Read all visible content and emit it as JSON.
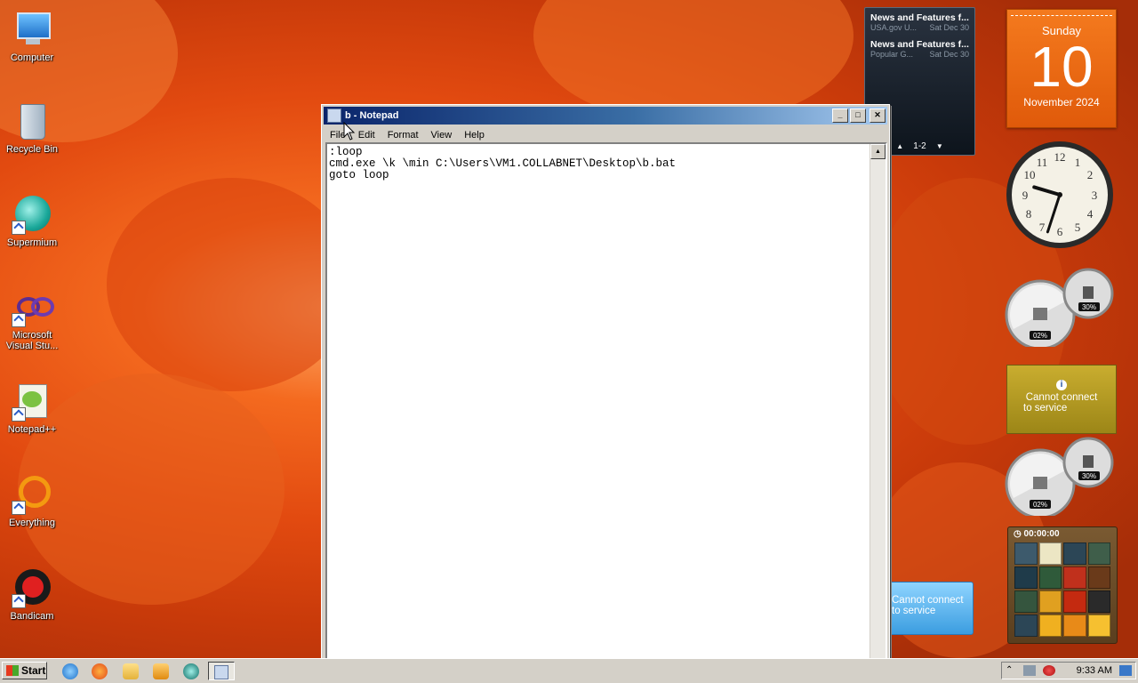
{
  "desktop": {
    "icons": [
      {
        "label": "Computer",
        "icon": "computer-icon"
      },
      {
        "label": "Recycle Bin",
        "icon": "recycle-bin-icon"
      },
      {
        "label": "Supermium",
        "icon": "supermium-icon"
      },
      {
        "label": "Microsoft Visual Stu...",
        "icon": "visual-studio-icon"
      },
      {
        "label": "Notepad++",
        "icon": "notepadpp-icon"
      },
      {
        "label": "Everything",
        "icon": "everything-icon"
      },
      {
        "label": "Bandicam",
        "icon": "bandicam-icon"
      }
    ]
  },
  "notepad": {
    "title": "b - Notepad",
    "menu": [
      "File",
      "Edit",
      "Format",
      "View",
      "Help"
    ],
    "content": ":loop\ncmd.exe \\k \\min C:\\Users\\VM1.COLLABNET\\Desktop\\b.bat\ngoto loop",
    "buttons": {
      "minimize": "_",
      "maximize": "□",
      "close": "✕"
    }
  },
  "gadgets": {
    "news": {
      "items": [
        {
          "headline": "News and Features f...",
          "source": "USA.gov U...",
          "date": "Sat Dec 30"
        },
        {
          "headline": "News and Features f...",
          "source": "Popular G...",
          "date": "Sat Dec 30"
        }
      ],
      "pager": "1-2"
    },
    "calendar": {
      "weekday": "Sunday",
      "day": "10",
      "month_year": "November 2024"
    },
    "clock": {
      "hour": 9,
      "minute": 33
    },
    "meters": [
      {
        "cpu": "02%",
        "memory": "30%"
      },
      {
        "cpu": "02%",
        "memory": "30%"
      }
    ],
    "weather_1": {
      "line1": "Cannot connect",
      "line2": "to service"
    },
    "weather_2": {
      "line1": "Cannot connect",
      "line2": "to service"
    },
    "puzzle": {
      "timer": "00:00:00"
    }
  },
  "taskbar": {
    "start_label": "Start",
    "clock": "9:33 AM"
  },
  "colors": {
    "titlebar_start": "#0a246a",
    "titlebar_end": "#a6caf0",
    "calendar_orange": "#e05a0a"
  }
}
